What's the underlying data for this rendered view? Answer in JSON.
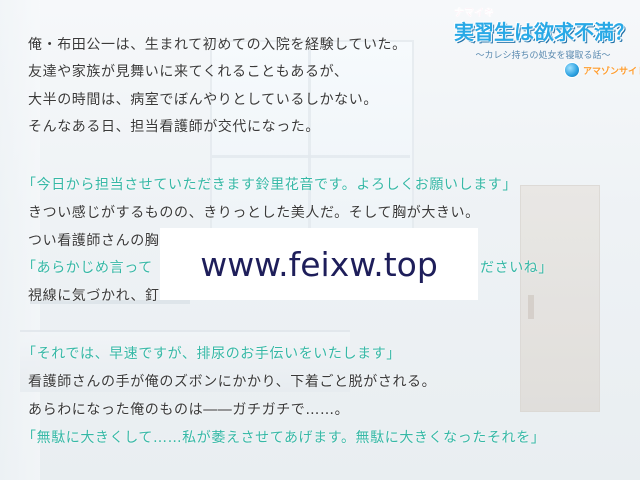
{
  "logo": {
    "top_small": "ナマイキ",
    "title": "実習生は欲求不満？",
    "subtitle": "～カレシ持ちの処女を寝取る話～",
    "brand": "アマゾンサイト"
  },
  "narration": [
    "俺・布田公一は、生まれて初めての入院を経験していた。",
    "友達や家族が見舞いに来てくれることもあるが、",
    "大半の時間は、病室でぼんやりとしているしかない。",
    "そんなある日、担当看護師が交代になった。",
    "「今日から担当させていただきます鈴里花音です。よろしくお願いします」",
    "きつい感じがするものの、きりっとした美人だ。そして胸が大きい。",
    "つい看護師さんの胸",
    "「あらかじめ言って",
    "ださいね」",
    "視線に気づかれ、釘",
    "「それでは、早速ですが、排尿のお手伝いをいたします」",
    "看護師さんの手が俺のズボンにかかり、下着ごと脱がされる。",
    "あらわになった俺のものは――ガチガチで……。",
    "「無駄に大きくして……私が萎えさせてあげます。無駄に大きくなったそれを」"
  ],
  "watermark": {
    "text": "www.feixw.top"
  },
  "colors": {
    "narration": "#3a3a3a",
    "speech": "#36b8a6",
    "logo_blue": "#29a9e6",
    "logo_pink": "#ff5fa2"
  }
}
